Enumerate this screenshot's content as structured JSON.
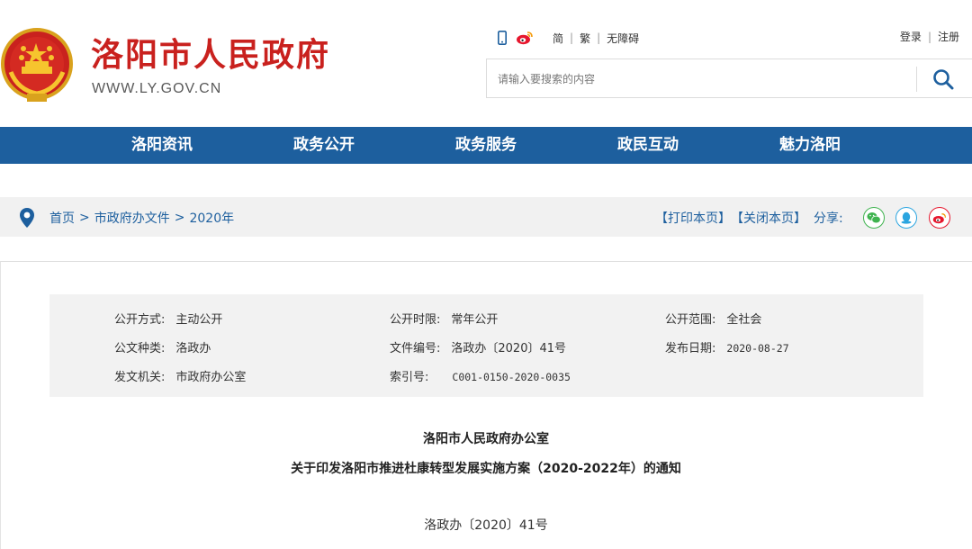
{
  "header": {
    "site_name": "洛阳市人民政府",
    "site_url": "WWW.LY.GOV.CN",
    "lang_simplified": "简",
    "lang_traditional": "繁",
    "accessibility": "无障碍",
    "login": "登录",
    "register": "注册",
    "search_placeholder": "请输入要搜索的内容",
    "icons": [
      "mobile-icon",
      "weibo-icon",
      "search-icon",
      "national-emblem"
    ]
  },
  "nav": {
    "items": [
      "洛阳资讯",
      "政务公开",
      "政务服务",
      "政民互动",
      "魅力洛阳"
    ]
  },
  "breadcrumb": {
    "items": [
      "首页",
      "市政府办文件",
      "2020年"
    ],
    "separator": ">"
  },
  "actions": {
    "print": "【打印本页】",
    "close": "【关闭本页】",
    "share_label": "分享:",
    "share_icons": [
      "wechat-icon",
      "qq-icon",
      "weibo-icon"
    ]
  },
  "meta": {
    "disclosure_method_label": "公开方式:",
    "disclosure_method": "主动公开",
    "disclosure_period_label": "公开时限:",
    "disclosure_period": "常年公开",
    "disclosure_scope_label": "公开范围:",
    "disclosure_scope": "全社会",
    "doc_type_label": "公文种类:",
    "doc_type": "洛政办",
    "doc_number_label": "文件编号:",
    "doc_number": "洛政办〔2020〕41号",
    "publish_date_label": "发布日期:",
    "publish_date": "2020-08-27",
    "issuer_label": "发文机关:",
    "issuer": "市政府办公室",
    "index_label": "索引号:",
    "index_no": "C001-0150-2020-0035"
  },
  "document": {
    "issuer": "洛阳市人民政府办公室",
    "title": "关于印发洛阳市推进杜康转型发展实施方案（2020-2022年）的通知",
    "number": "洛政办〔2020〕41号"
  },
  "colors": {
    "brand_red": "#c9211e",
    "nav_blue": "#1d5f9e",
    "wechat_green": "#3fb34f",
    "qq_blue": "#2ba5e0",
    "weibo_red": "#e6162d"
  }
}
